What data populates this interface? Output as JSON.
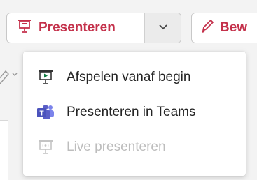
{
  "toolbar": {
    "present_label": "Presenteren",
    "edit_label": "Bew"
  },
  "menu": {
    "items": [
      {
        "label": "Afspelen vanaf begin",
        "icon": "play-from-start-icon",
        "enabled": true
      },
      {
        "label": "Presenteren in Teams",
        "icon": "teams-icon",
        "enabled": true
      },
      {
        "label": "Live presenteren",
        "icon": "live-present-icon",
        "enabled": false
      }
    ]
  },
  "colors": {
    "accent": "#c4314b",
    "teams": "#5b5fc7",
    "play_green": "#107c41",
    "disabled": "#bdbdbd"
  }
}
